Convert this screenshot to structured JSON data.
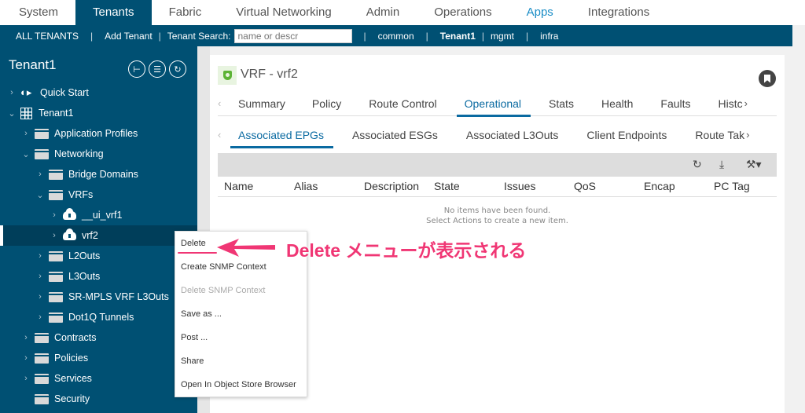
{
  "topnav": {
    "tabs": [
      "System",
      "Tenants",
      "Fabric",
      "Virtual Networking",
      "Admin",
      "Operations",
      "Apps",
      "Integrations"
    ],
    "active": "Tenants"
  },
  "subnav": {
    "all_tenants": "ALL TENANTS",
    "add_tenant": "Add Tenant",
    "search_label": "Tenant Search:",
    "search_placeholder": "name or descr",
    "tenants": [
      "common",
      "Tenant1",
      "mgmt",
      "infra"
    ],
    "separator": "|"
  },
  "sidebar": {
    "title": "Tenant1",
    "icons": [
      "add-tenant-icon",
      "filter-icon",
      "refresh-icon"
    ],
    "tree": [
      {
        "label": "Quick Start",
        "caret": ">",
        "icon": "quick-start-icon"
      },
      {
        "label": "Tenant1",
        "caret": "v",
        "icon": "building-icon"
      },
      {
        "label": "Application Profiles",
        "caret": ">",
        "icon": "folder-icon"
      },
      {
        "label": "Networking",
        "caret": "v",
        "icon": "folder-icon"
      },
      {
        "label": "Bridge Domains",
        "caret": ">",
        "icon": "folder-icon"
      },
      {
        "label": "VRFs",
        "caret": "v",
        "icon": "folder-icon"
      },
      {
        "label": "__ui_vrf1",
        "caret": ">",
        "icon": "cloud-icon"
      },
      {
        "label": "vrf2",
        "caret": ">",
        "icon": "cloud-icon",
        "selected": true
      },
      {
        "label": "L2Outs",
        "caret": ">",
        "icon": "folder-icon"
      },
      {
        "label": "L3Outs",
        "caret": ">",
        "icon": "folder-icon"
      },
      {
        "label": "SR-MPLS VRF L3Outs",
        "caret": ">",
        "icon": "folder-icon"
      },
      {
        "label": "Dot1Q Tunnels",
        "caret": ">",
        "icon": "folder-icon"
      },
      {
        "label": "Contracts",
        "caret": ">",
        "icon": "folder-icon"
      },
      {
        "label": "Policies",
        "caret": ">",
        "icon": "folder-icon"
      },
      {
        "label": "Services",
        "caret": ">",
        "icon": "folder-icon"
      },
      {
        "label": "Security",
        "caret": "",
        "icon": "folder-icon"
      }
    ]
  },
  "panel": {
    "title": "VRF - vrf2",
    "tabs": [
      "Summary",
      "Policy",
      "Route Control",
      "Operational",
      "Stats",
      "Health",
      "Faults",
      "Histc"
    ],
    "active_tab": "Operational",
    "subtabs": [
      "Associated EPGs",
      "Associated ESGs",
      "Associated L3Outs",
      "Client Endpoints",
      "Route Tak"
    ],
    "active_subtab": "Associated EPGs",
    "columns": [
      "Name",
      "Alias",
      "Description",
      "State",
      "Issues",
      "QoS",
      "Encap",
      "PC Tag"
    ],
    "empty_line1": "No items have been found.",
    "empty_line2": "Select Actions to create a new item."
  },
  "context_menu": {
    "items": [
      {
        "label": "Delete",
        "disabled": false
      },
      {
        "label": "Create SNMP Context",
        "disabled": false
      },
      {
        "label": "Delete SNMP Context",
        "disabled": true
      },
      {
        "label": "Save as ...",
        "disabled": false
      },
      {
        "label": "Post ...",
        "disabled": false
      },
      {
        "label": "Share",
        "disabled": false
      },
      {
        "label": "Open In Object Store Browser",
        "disabled": false
      }
    ]
  },
  "annotation": {
    "text": "Delete メニューが表示される",
    "color": "#f03674"
  },
  "colors": {
    "brand": "#005073",
    "accent": "#0a6aa1",
    "apps_link": "#1a8dc6"
  }
}
